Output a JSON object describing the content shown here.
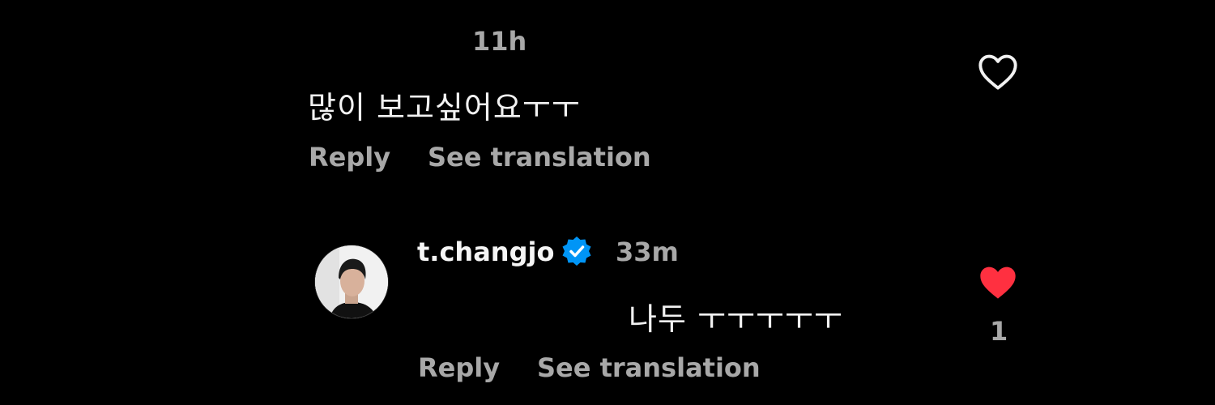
{
  "comment1": {
    "time": "11h",
    "text": "많이 보고싶어요ㅜㅜ",
    "reply_label": "Reply",
    "translate_label": "See translation",
    "liked": false,
    "like_icon": "heart-outline-icon"
  },
  "reply1": {
    "username": "t.changjo",
    "verified_icon": "verified-badge-icon",
    "time": "33m",
    "text": "나두 ㅜㅜㅜㅜㅜ",
    "reply_label": "Reply",
    "translate_label": "See translation",
    "liked": true,
    "like_icon": "heart-filled-icon",
    "like_count": "1",
    "colors": {
      "heart": "#ff3040",
      "verified": "#0095f6"
    }
  }
}
